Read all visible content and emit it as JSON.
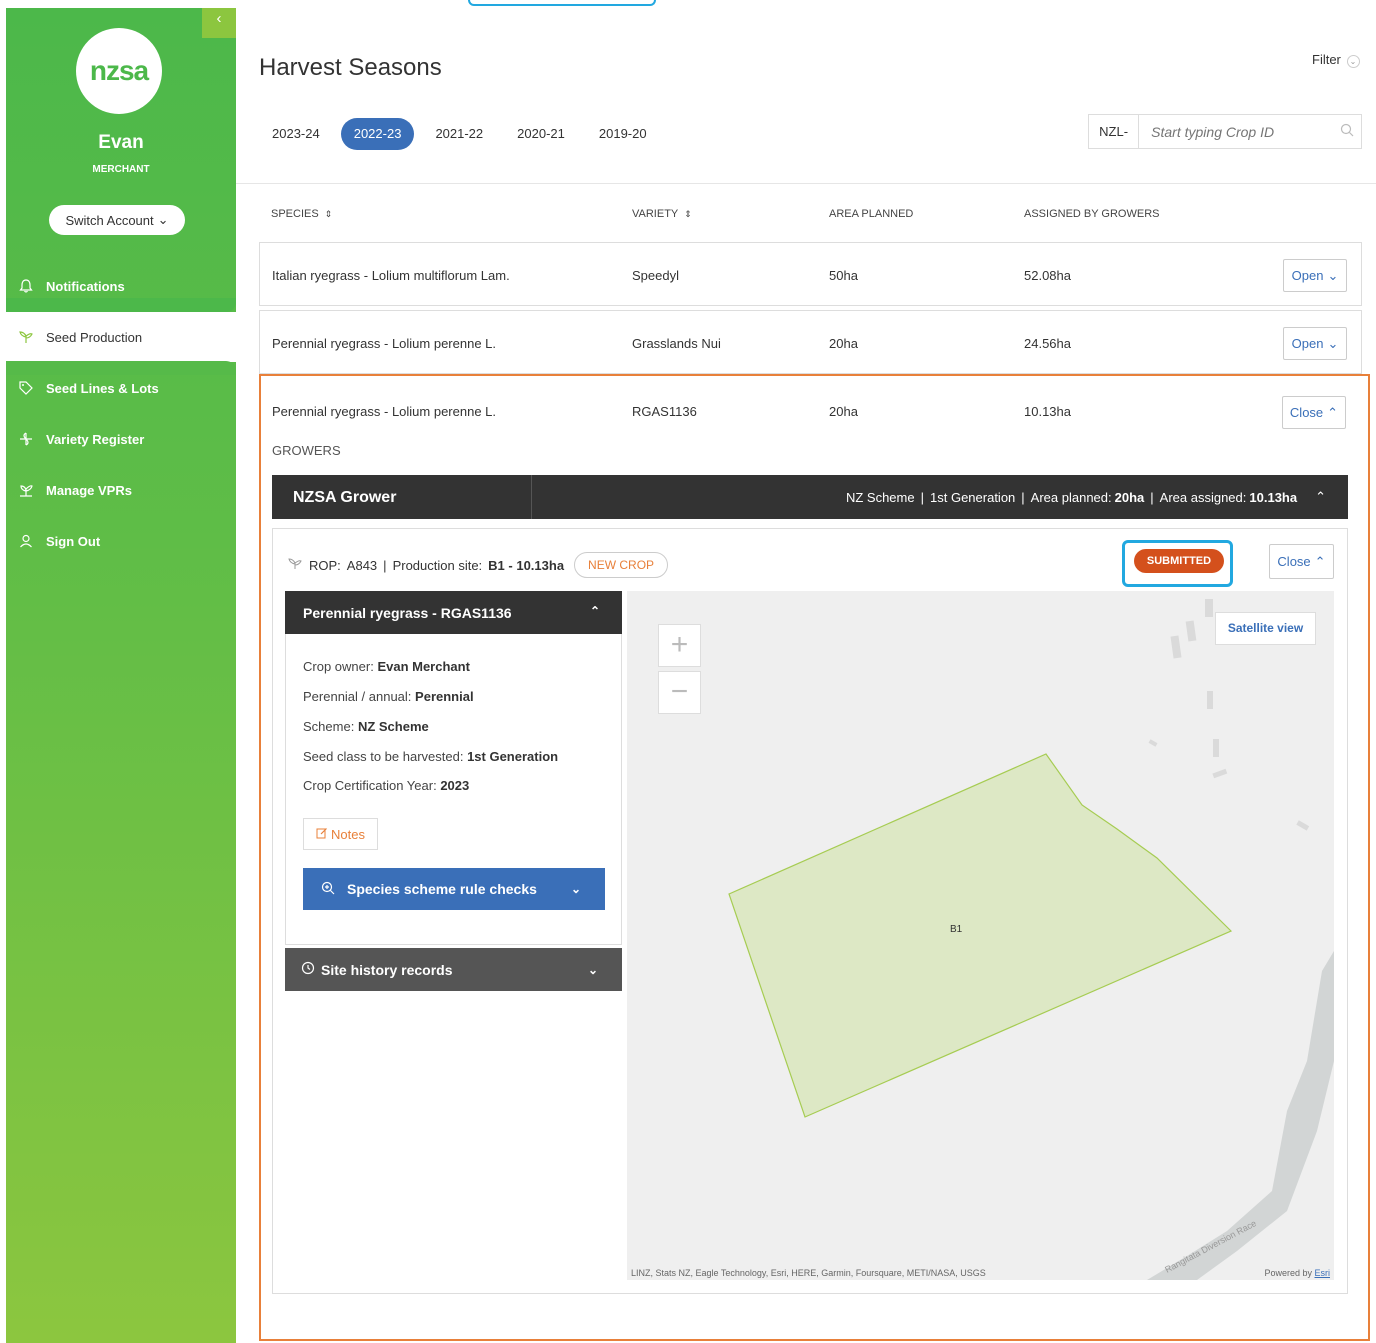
{
  "sidebar": {
    "collapse": "‹",
    "logo": "nzsa",
    "user_name": "Evan",
    "user_role": "MERCHANT",
    "switch_account": "Switch Account",
    "items": [
      {
        "label": "Notifications",
        "icon": "bell-icon"
      },
      {
        "label": "Seed Production",
        "icon": "seedling-icon"
      },
      {
        "label": "Seed Lines & Lots",
        "icon": "tag-icon"
      },
      {
        "label": "Variety Register",
        "icon": "sprout-icon"
      },
      {
        "label": "Manage VPRs",
        "icon": "plant-icon"
      },
      {
        "label": "Sign Out",
        "icon": "user-icon"
      }
    ]
  },
  "header": {
    "title": "Harvest Seasons",
    "filter": "Filter",
    "tabs": [
      "2023-24",
      "2022-23",
      "2021-22",
      "2020-21",
      "2019-20"
    ],
    "active_tab": "2022-23",
    "search_prefix": "NZL-",
    "search_placeholder": "Start typing Crop ID"
  },
  "table": {
    "columns": [
      "SPECIES",
      "VARIETY",
      "AREA PLANNED",
      "ASSIGNED BY GROWERS"
    ],
    "rows": [
      {
        "species": "Italian ryegrass - Lolium multiflorum Lam.",
        "variety": "Speedyl",
        "area_planned": "50ha",
        "assigned": "52.08ha",
        "action": "Open"
      },
      {
        "species": "Perennial ryegrass - Lolium perenne L.",
        "variety": "Grasslands Nui",
        "area_planned": "20ha",
        "assigned": "24.56ha",
        "action": "Open"
      },
      {
        "species": "Perennial ryegrass - Lolium perenne L.",
        "variety": "RGAS1136",
        "area_planned": "20ha",
        "assigned": "10.13ha",
        "action": "Close"
      }
    ]
  },
  "growers": {
    "label": "GROWERS",
    "name": "NZSA Grower",
    "scheme": "NZ Scheme",
    "generation": "1st Generation",
    "area_planned_label": "Area planned:",
    "area_planned": "20ha",
    "area_assigned_label": "Area assigned:",
    "area_assigned": "10.13ha"
  },
  "crop": {
    "rop_label": "ROP:",
    "rop": "A843",
    "site_label": "Production site:",
    "site": "B1 - 10.13ha",
    "new_crop": "NEW CROP",
    "status": "SUBMITTED",
    "close": "Close",
    "panel_title": "Perennial ryegrass - RGAS1136",
    "fields": [
      {
        "label": "Crop owner:",
        "value": "Evan Merchant"
      },
      {
        "label": "Perennial / annual:",
        "value": "Perennial"
      },
      {
        "label": "Scheme:",
        "value": "NZ Scheme"
      },
      {
        "label": "Seed class to be harvested:",
        "value": "1st Generation"
      },
      {
        "label": "Crop Certification Year:",
        "value": "2023"
      }
    ],
    "notes": "Notes",
    "rule_checks": "Species scheme rule checks",
    "site_history": "Site history records"
  },
  "map": {
    "zoom_in": "+",
    "zoom_out": "−",
    "satellite": "Satellite view",
    "paddock_label": "B1",
    "road_label": "Rangitata Diversion Race",
    "credit": "LINZ, Stats NZ, Eagle Technology, Esri, HERE, Garmin, Foursquare, METI/NASA, USGS",
    "powered_prefix": "Powered by",
    "powered_link": "Esri"
  },
  "colors": {
    "sidebar_green": "#4cb84a",
    "sidebar_lime": "#8cc63f",
    "accent_blue": "#3a6fb8",
    "orange": "#e8803a",
    "submitted": "#d4501c",
    "highlight": "#22a8e0",
    "paddock_fill": "#dde8c5",
    "paddock_stroke": "#a6cc52"
  }
}
